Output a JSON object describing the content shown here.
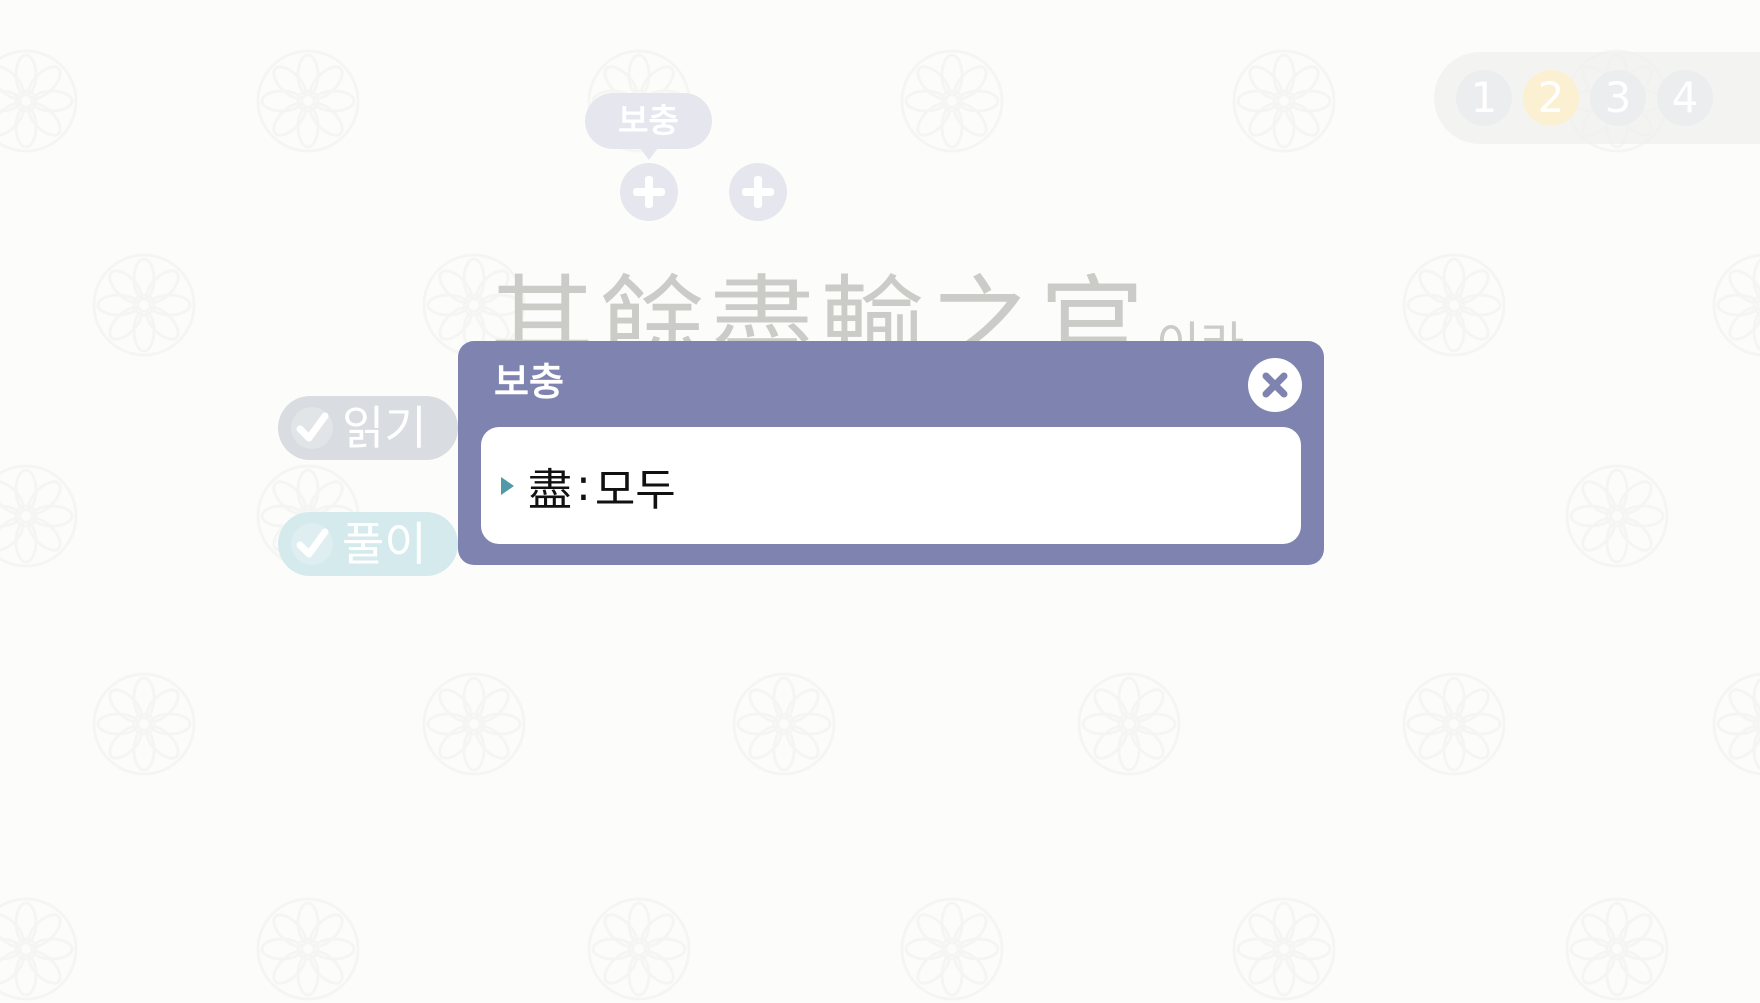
{
  "pagination": {
    "pages": [
      "1",
      "2",
      "3",
      "4"
    ],
    "active_index": 1
  },
  "supplement_tooltip": {
    "label": "보충"
  },
  "sentence": {
    "hanja": "其餘盡輸之官",
    "suffix": "이라."
  },
  "toggles": {
    "read_label": "읽기",
    "explain_label": "풀이"
  },
  "popup": {
    "title": "보충",
    "entry": {
      "character": "盡",
      "separator": ":",
      "meaning": "모두"
    }
  },
  "colors": {
    "popup_header": "#7e83b0",
    "active_page": "#fbf0d2",
    "bullet": "#4f9aa6"
  }
}
